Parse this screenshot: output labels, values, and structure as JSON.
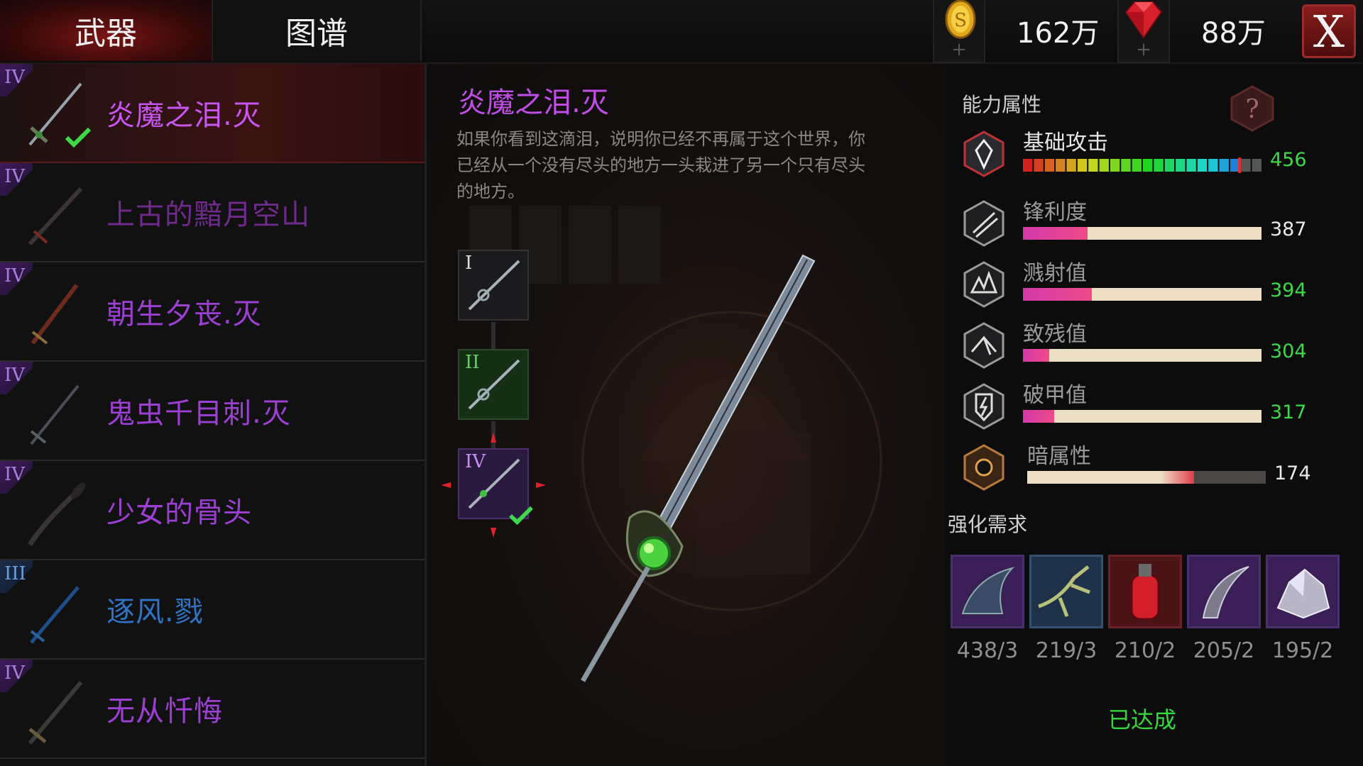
{
  "tabs": {
    "weapons": "武器",
    "codex": "图谱"
  },
  "currency": {
    "gold": "162万",
    "gems": "88万",
    "close": "X"
  },
  "weapons": [
    {
      "tier": "IV",
      "name": "炎魔之泪.灭",
      "selected": true
    },
    {
      "tier": "IV",
      "name": "上古的黯月空山"
    },
    {
      "tier": "IV",
      "name": "朝生夕丧.灭"
    },
    {
      "tier": "IV",
      "name": "鬼虫千目刺.灭"
    },
    {
      "tier": "IV",
      "name": "少女的骨头"
    },
    {
      "tier": "III",
      "name": "逐风.戮"
    },
    {
      "tier": "IV",
      "name": "无从忏悔"
    }
  ],
  "detail": {
    "title": "炎魔之泪.灭",
    "description": "如果你看到这滴泪，说明你已经不再属于这个世界，你已经从一个没有尽头的地方一头栽进了另一个只有尽头的地方。",
    "slots": [
      "I",
      "II",
      "IV"
    ]
  },
  "stats": {
    "header": "能力属性",
    "items": [
      {
        "name": "基础攻击",
        "value": "456",
        "fill": 0.9,
        "color": "#3ed94a",
        "icon": "sword-shield-icon"
      },
      {
        "name": "锋利度",
        "value": "387",
        "fill": 0.27,
        "color": "#e8e8e8",
        "icon": "sharpness-icon"
      },
      {
        "name": "溅射值",
        "value": "394",
        "fill": 0.29,
        "color": "#3ed94a",
        "icon": "splash-icon"
      },
      {
        "name": "致残值",
        "value": "304",
        "fill": 0.11,
        "color": "#3ed94a",
        "icon": "cripple-icon"
      },
      {
        "name": "破甲值",
        "value": "317",
        "fill": 0.13,
        "color": "#3ed94a",
        "icon": "armor-break-icon"
      },
      {
        "name": "暗属性",
        "value": "174",
        "fill": 0.7,
        "color": "#e8e8e8",
        "icon": "dark-element-icon"
      }
    ]
  },
  "requirements": {
    "title": "强化需求",
    "materials": [
      {
        "icon": "dark-fin-icon",
        "count": "438/3"
      },
      {
        "icon": "bone-claw-icon",
        "count": "219/3"
      },
      {
        "icon": "blood-vial-icon",
        "count": "210/2"
      },
      {
        "icon": "scythe-blade-icon",
        "count": "205/2"
      },
      {
        "icon": "crystal-ore-icon",
        "count": "195/2"
      }
    ],
    "status": "已达成"
  }
}
